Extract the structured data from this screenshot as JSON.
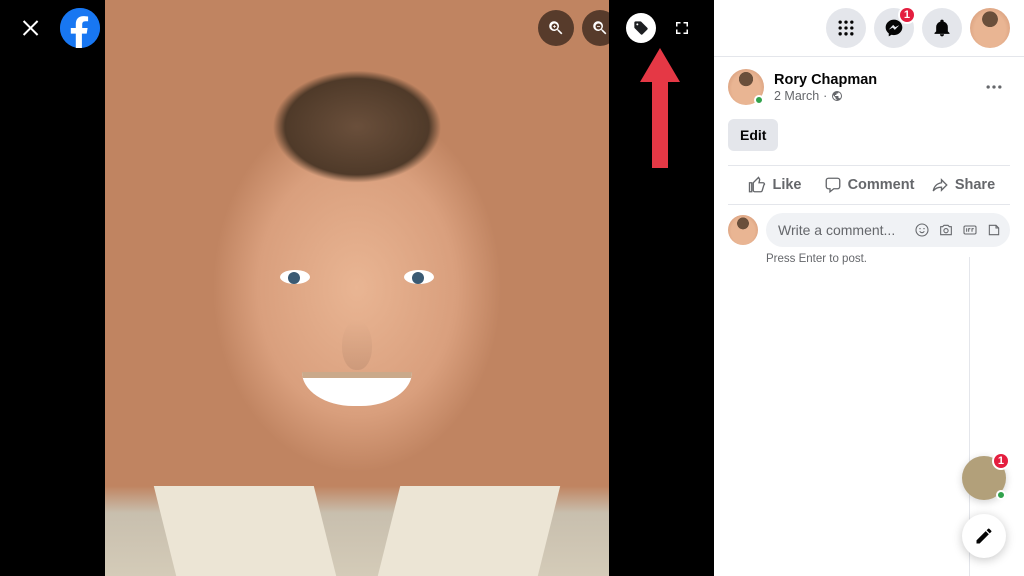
{
  "post": {
    "author_name": "Rory Chapman",
    "timestamp": "2 March",
    "edit_label": "Edit"
  },
  "actions": {
    "like": "Like",
    "comment": "Comment",
    "share": "Share"
  },
  "compose": {
    "placeholder": "Write a comment...",
    "hint": "Press Enter to post."
  },
  "header": {
    "messenger_badge": "1"
  },
  "chat": {
    "head_badge": "1"
  }
}
